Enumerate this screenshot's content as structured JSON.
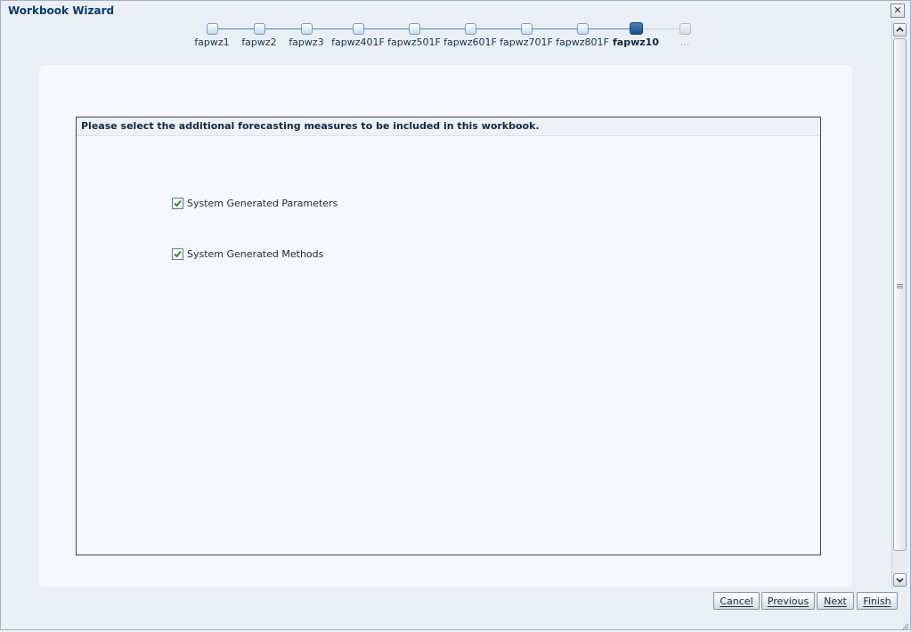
{
  "dialog": {
    "title": "Workbook Wizard",
    "close_symbol": "✕"
  },
  "train": {
    "stops": [
      {
        "label": "fapwz1",
        "state": "visited"
      },
      {
        "label": "fapwz2",
        "state": "visited"
      },
      {
        "label": "fapwz3",
        "state": "visited"
      },
      {
        "label": "fapwz401F",
        "state": "visited"
      },
      {
        "label": "fapwz501F",
        "state": "visited"
      },
      {
        "label": "fapwz601F",
        "state": "visited"
      },
      {
        "label": "fapwz701F",
        "state": "visited"
      },
      {
        "label": "fapwz801F",
        "state": "visited"
      },
      {
        "label": "fapwz10",
        "state": "current"
      },
      {
        "label": "...",
        "state": "disabled"
      }
    ]
  },
  "main": {
    "instruction": "Please select the additional forecasting measures to be included in this workbook.",
    "options": [
      {
        "label": "System Generated Parameters",
        "checked": true
      },
      {
        "label": "System Generated Methods",
        "checked": true
      }
    ]
  },
  "footer": {
    "cancel": "Cancel",
    "previous": "Previous",
    "next": "Next",
    "finish": "Finish"
  },
  "colors": {
    "accent": "#1e4f8a",
    "check": "#2f8a2f"
  }
}
